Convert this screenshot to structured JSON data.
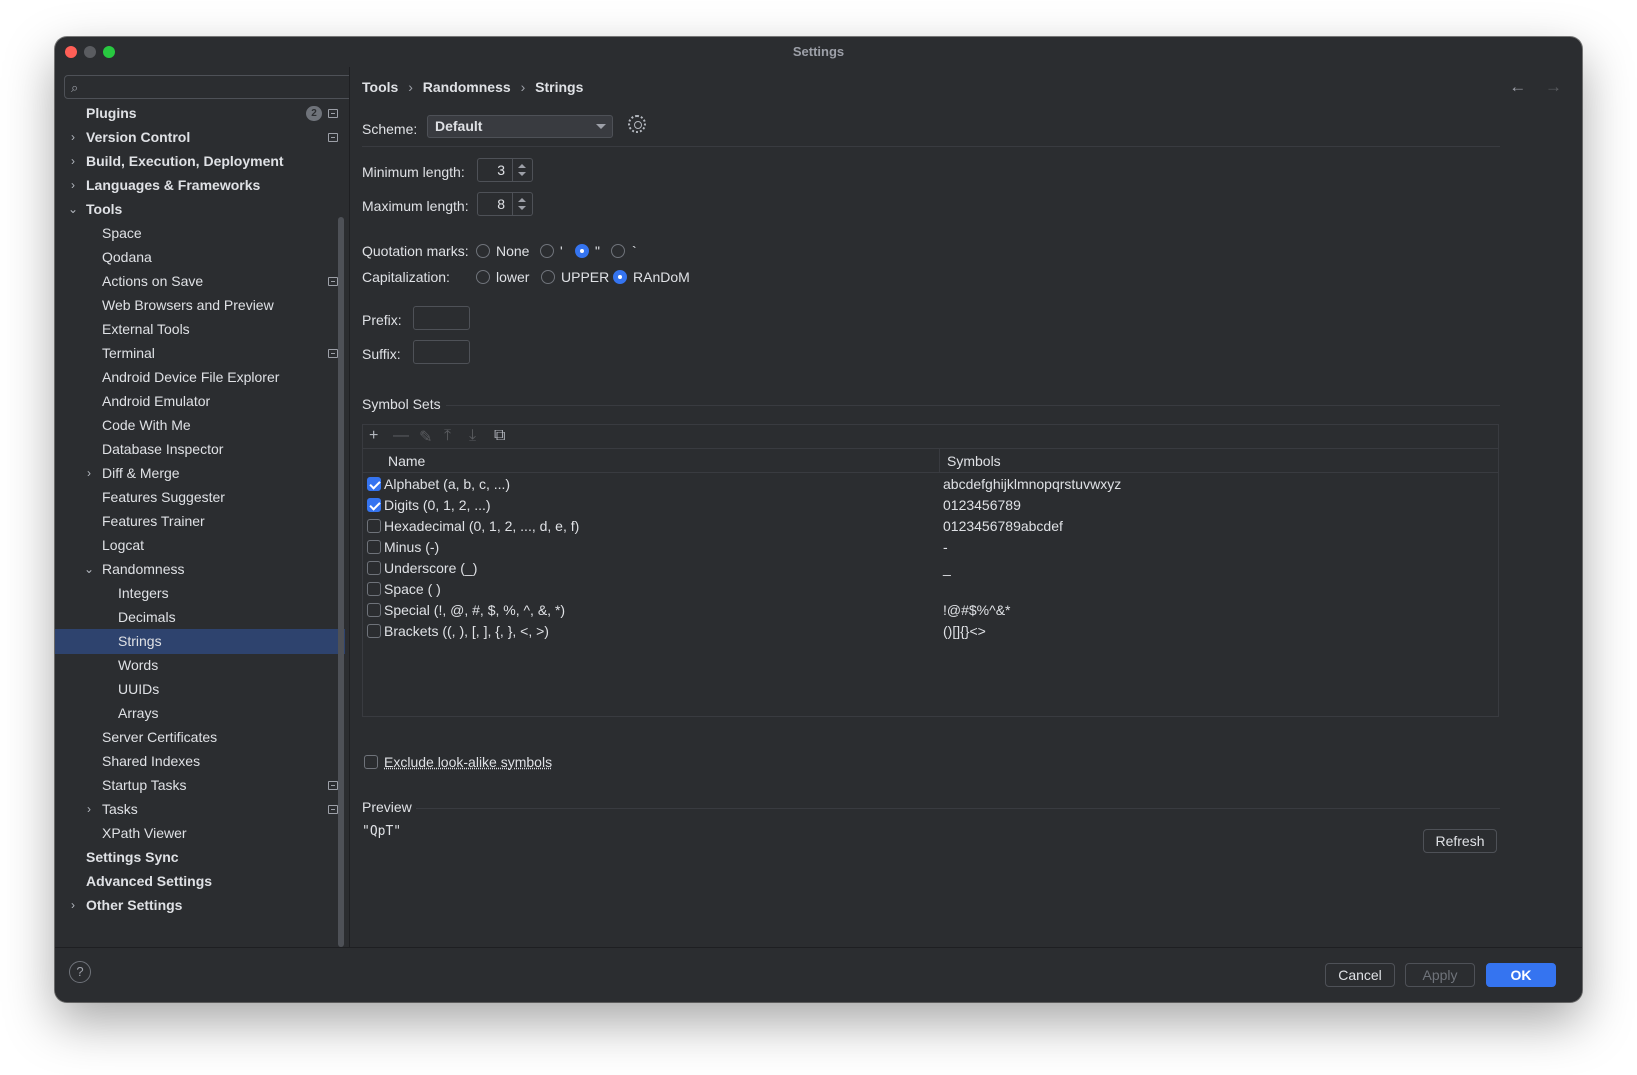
{
  "window": {
    "title": "Settings"
  },
  "sidebar": {
    "search_placeholder": "",
    "plugins_badge": "2",
    "items": [
      {
        "label": "Plugins",
        "bold": true
      },
      {
        "label": "Version Control",
        "bold": true
      },
      {
        "label": "Build, Execution, Deployment",
        "bold": true
      },
      {
        "label": "Languages & Frameworks",
        "bold": true
      },
      {
        "label": "Tools",
        "bold": true
      },
      {
        "label": "Space"
      },
      {
        "label": "Qodana"
      },
      {
        "label": "Actions on Save"
      },
      {
        "label": "Web Browsers and Preview"
      },
      {
        "label": "External Tools"
      },
      {
        "label": "Terminal"
      },
      {
        "label": "Android Device File Explorer"
      },
      {
        "label": "Android Emulator"
      },
      {
        "label": "Code With Me"
      },
      {
        "label": "Database Inspector"
      },
      {
        "label": "Diff & Merge"
      },
      {
        "label": "Features Suggester"
      },
      {
        "label": "Features Trainer"
      },
      {
        "label": "Logcat"
      },
      {
        "label": "Randomness"
      },
      {
        "label": "Integers"
      },
      {
        "label": "Decimals"
      },
      {
        "label": "Strings"
      },
      {
        "label": "Words"
      },
      {
        "label": "UUIDs"
      },
      {
        "label": "Arrays"
      },
      {
        "label": "Server Certificates"
      },
      {
        "label": "Shared Indexes"
      },
      {
        "label": "Startup Tasks"
      },
      {
        "label": "Tasks"
      },
      {
        "label": "XPath Viewer"
      },
      {
        "label": "Settings Sync",
        "bold": true
      },
      {
        "label": "Advanced Settings",
        "bold": true
      },
      {
        "label": "Other Settings",
        "bold": true
      }
    ]
  },
  "breadcrumb": {
    "c1": "Tools",
    "c2": "Randomness",
    "c3": "Strings",
    "sep": "›"
  },
  "nav": {
    "back": "←",
    "forward": "→"
  },
  "scheme": {
    "label": "Scheme:",
    "value": "Default"
  },
  "min_length": {
    "label": "Minimum length:",
    "value": "3"
  },
  "max_length": {
    "label": "Maximum length:",
    "value": "8"
  },
  "quotation": {
    "label": "Quotation marks:",
    "options": [
      "None",
      "'",
      "\"",
      "`"
    ],
    "selected": "\""
  },
  "capitalization": {
    "label": "Capitalization:",
    "options": [
      "lower",
      "UPPER",
      "RAnDoM"
    ],
    "selected": "RAnDoM"
  },
  "prefix": {
    "label": "Prefix:",
    "value": ""
  },
  "suffix": {
    "label": "Suffix:",
    "value": ""
  },
  "symbol_sets": {
    "title": "Symbol Sets",
    "toolbar": {
      "add": "+",
      "remove": "—",
      "edit": "✎",
      "up": "⤒",
      "down": "⤓",
      "copy": "⧉"
    },
    "columns": {
      "name": "Name",
      "symbols": "Symbols"
    },
    "rows": [
      {
        "name": "Alphabet (a, b, c, ...)",
        "symbols": "abcdefghijklmnopqrstuvwxyz",
        "checked": true
      },
      {
        "name": "Digits (0, 1, 2, ...)",
        "symbols": "0123456789",
        "checked": true
      },
      {
        "name": "Hexadecimal (0, 1, 2, ..., d, e, f)",
        "symbols": "0123456789abcdef",
        "checked": false
      },
      {
        "name": "Minus (-)",
        "symbols": "-",
        "checked": false
      },
      {
        "name": "Underscore (_)",
        "symbols": "_",
        "checked": false
      },
      {
        "name": "Space ( )",
        "symbols": "",
        "checked": false
      },
      {
        "name": "Special (!, @, #, $, %, ^, &, *)",
        "symbols": "!@#$%^&*",
        "checked": false
      },
      {
        "name": "Brackets ((, ), [, ], {, }, <, >)",
        "symbols": "()[]{}<>",
        "checked": false
      }
    ]
  },
  "exclude": {
    "label": "Exclude look-alike symbols",
    "checked": false
  },
  "preview": {
    "title": "Preview",
    "value": "\"QpT\"",
    "refresh": "Refresh"
  },
  "footer": {
    "help": "?",
    "cancel": "Cancel",
    "apply": "Apply",
    "ok": "OK"
  }
}
